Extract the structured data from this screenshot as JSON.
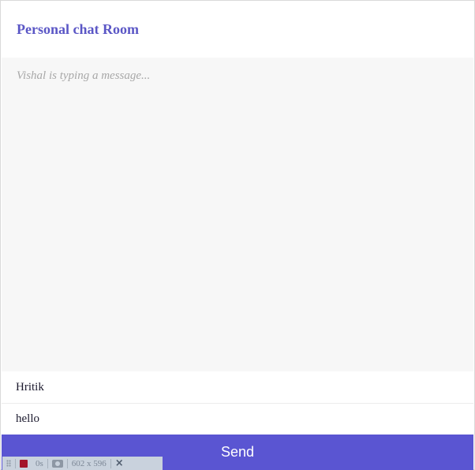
{
  "header": {
    "title": "Personal chat Room"
  },
  "chat": {
    "typing_indicator": "Vishal is typing a message..."
  },
  "form": {
    "name_value": "Hritik",
    "message_value": "hello",
    "send_label": "Send"
  },
  "recorder_toolbar": {
    "time": "0s",
    "dimensions": "602 x 596",
    "close_symbol": "×",
    "icons": [
      "drag-handle-icon",
      "record-icon",
      "camera-icon",
      "close-icon"
    ]
  },
  "colors": {
    "accent": "#5a55d2",
    "title": "#5b57c6",
    "chat_bg": "#f7f7f7",
    "typing_text": "#a8a8a8"
  }
}
